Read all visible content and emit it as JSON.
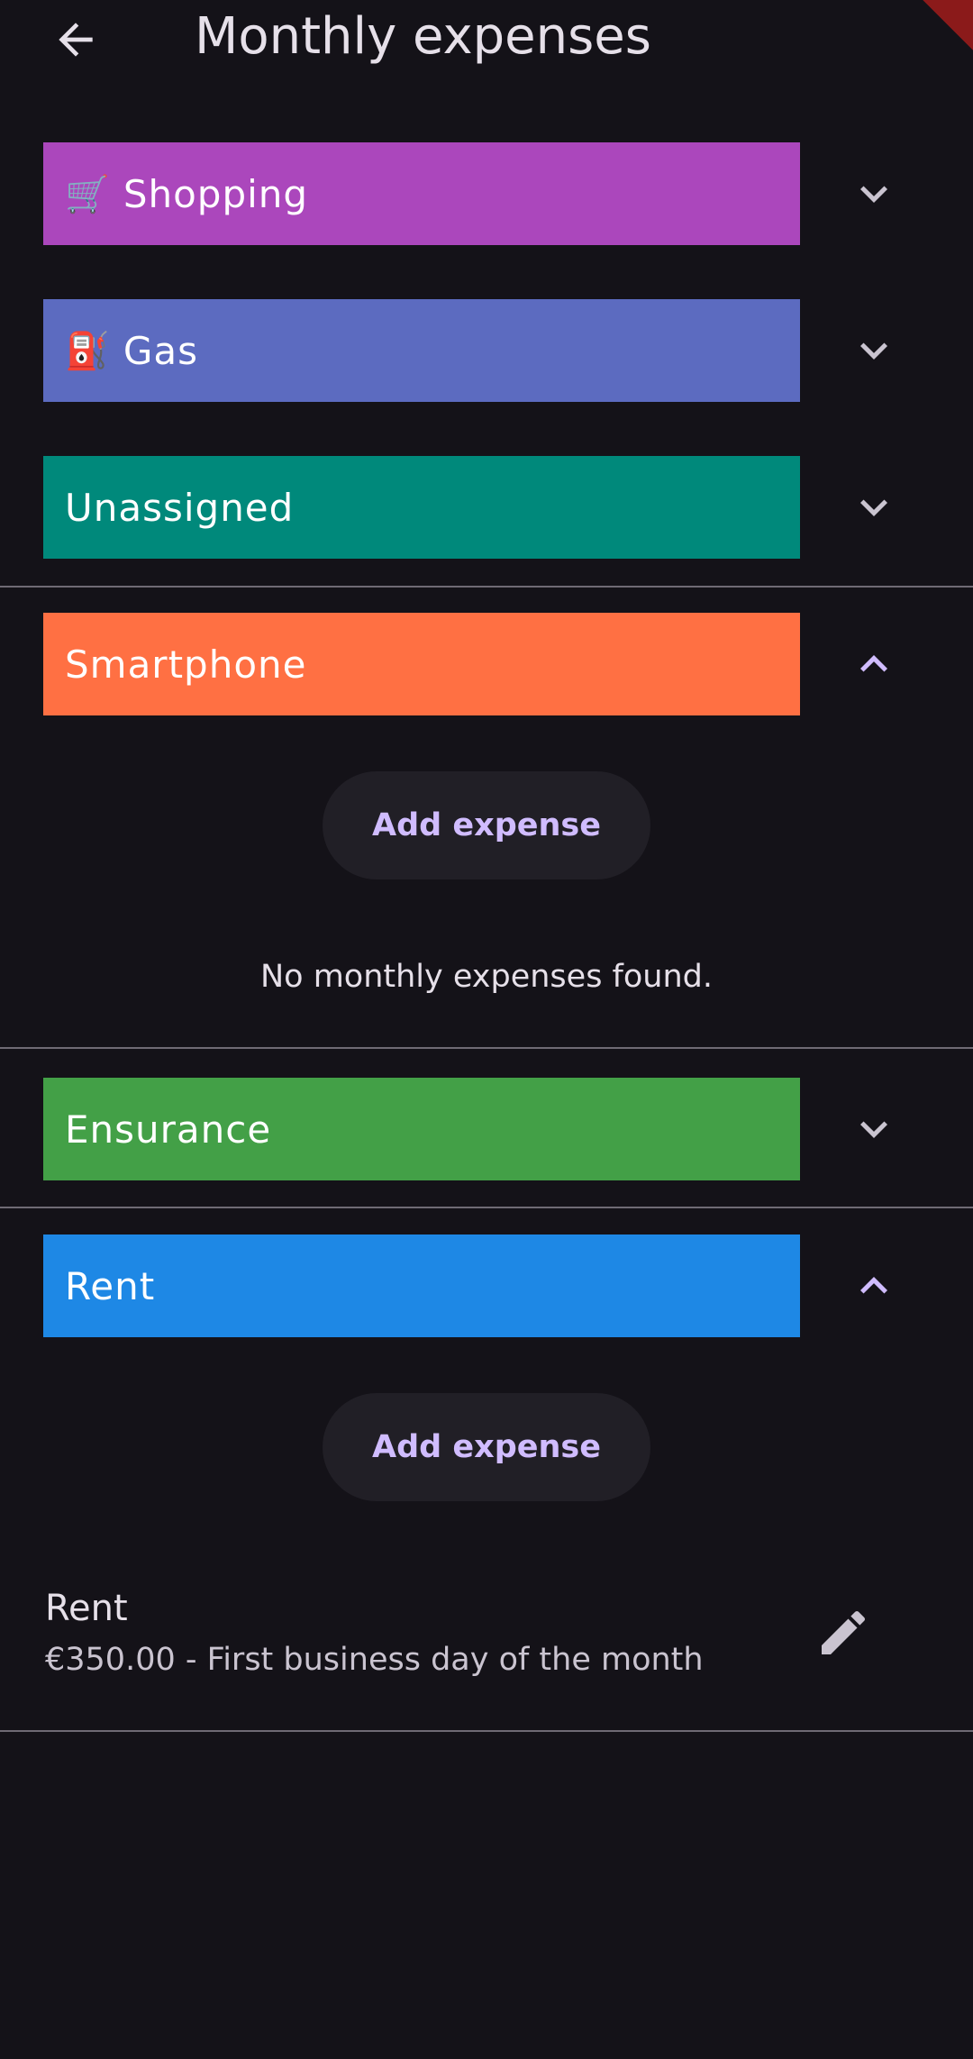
{
  "app": {
    "title": "Monthly expenses"
  },
  "colors": {
    "background": "#141218",
    "accent": "#d0bcff",
    "shopping": "#ab47bc",
    "gas": "#5c6bc0",
    "unassigned": "#00897b",
    "smartphone": "#ff7043",
    "ensurance": "#43a047",
    "rent": "#1e88e5"
  },
  "categories": [
    {
      "name": "Shopping",
      "emoji": "🛒",
      "expanded": false,
      "chevron": "chevron-down-icon"
    },
    {
      "name": "Gas",
      "emoji": "⛽",
      "expanded": false,
      "chevron": "chevron-down-icon"
    },
    {
      "name": "Unassigned",
      "emoji": "",
      "expanded": false,
      "chevron": "chevron-down-icon"
    },
    {
      "name": "Smartphone",
      "emoji": "",
      "expanded": true,
      "chevron": "chevron-up-icon",
      "add_label": "Add expense",
      "empty_message": "No monthly expenses found."
    },
    {
      "name": "Ensurance",
      "emoji": "",
      "expanded": false,
      "chevron": "chevron-down-icon"
    },
    {
      "name": "Rent",
      "emoji": "",
      "expanded": true,
      "chevron": "chevron-up-icon",
      "add_label": "Add expense",
      "expenses": [
        {
          "title": "Rent",
          "subtitle": "€350.00 - First business day of the month"
        }
      ]
    }
  ]
}
